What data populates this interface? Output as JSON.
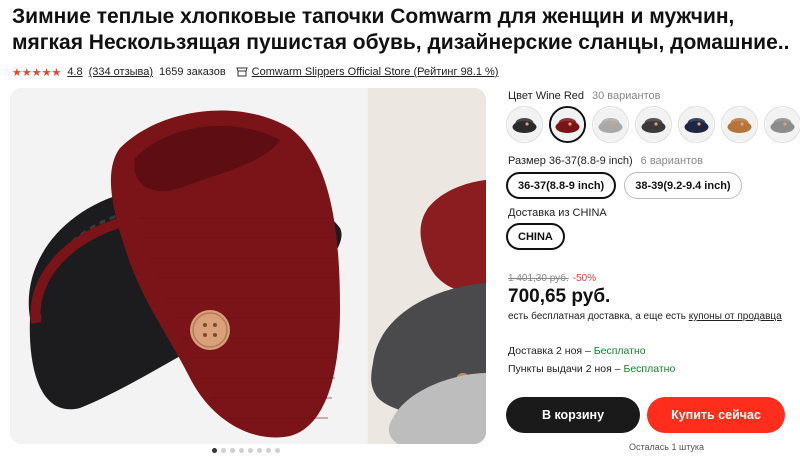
{
  "product": {
    "title_line1": "Зимние теплые хлопковые тапочки Comwarm для женщин и мужчин,",
    "title_line2": "мягкая Нескользящая пушистая обувь, дизайнерские сланцы, домашние..",
    "stars": "★★★★★",
    "rating": "4.8",
    "reviews": "(334 отзыва)",
    "orders": "1659 заказов",
    "store": "Comwarm Slippers Official Store (Рейтинг 98.1 %)"
  },
  "gallery": {
    "dots_count": 8,
    "active_dot": 0
  },
  "color": {
    "label": "Цвет Wine Red",
    "variants": "30 вариантов",
    "swatches": [
      {
        "name": "black-dark",
        "fill": "#2b2b2b",
        "selected": false
      },
      {
        "name": "wine-red",
        "fill": "#7a1418",
        "selected": true
      },
      {
        "name": "light-gray",
        "fill": "#a9a9a9",
        "selected": false
      },
      {
        "name": "charcoal",
        "fill": "#3a3a3d",
        "selected": false
      },
      {
        "name": "navy",
        "fill": "#1d2742",
        "selected": false
      },
      {
        "name": "camel",
        "fill": "#b5743a",
        "selected": false
      },
      {
        "name": "gray",
        "fill": "#8c8c8c",
        "selected": false
      }
    ]
  },
  "size": {
    "label": "Размер 36-37(8.8-9 inch)",
    "variants": "6 вариантов",
    "options": [
      "36-37(8.8-9 inch)",
      "38-39(9.2-9.4 inch)"
    ],
    "selected_index": 0
  },
  "shipping": {
    "label": "Доставка из CHINA",
    "option": "CHINA"
  },
  "price": {
    "old": "1 401,30 руб.",
    "discount": "-50%",
    "current": "700,65 руб.",
    "freeship_text": "есть бесплатная доставка, а еще есть ",
    "freeship_link": "купоны от продавца"
  },
  "delivery": {
    "delivery_text": "Доставка 2 ноя – ",
    "delivery_free": "Бесплатно",
    "pickup_text": "Пункты выдачи 2 ноя – ",
    "pickup_free": "Бесплатно"
  },
  "actions": {
    "cart": "В корзину",
    "buy": "Купить сейчас",
    "stock": "Осталась 1 штука"
  },
  "colors": {
    "accent": "#ff2d1b",
    "dark": "#1a1a1a",
    "free_green": "#0a8a2a"
  }
}
